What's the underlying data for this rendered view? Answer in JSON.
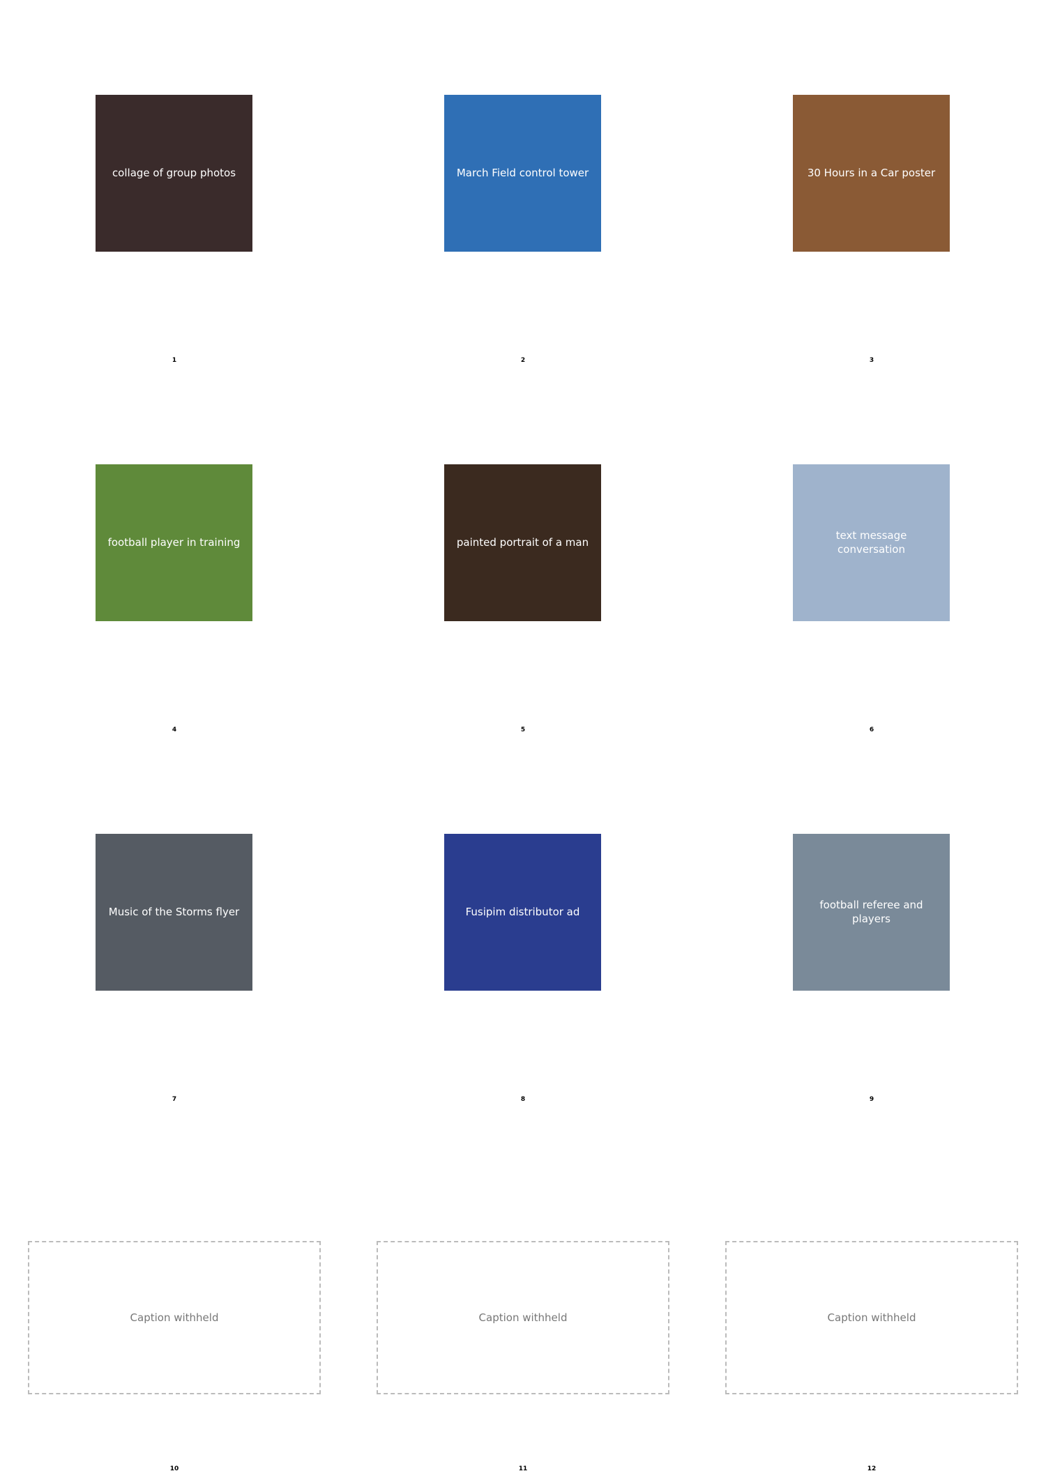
{
  "cells": [
    {
      "number": "1",
      "image": "collage of group photos",
      "bg": "#3a2b2b"
    },
    {
      "number": "2",
      "image": "March Field control tower",
      "bg": "#2f6fb5"
    },
    {
      "number": "3",
      "image": "30 Hours in a Car poster",
      "bg": "#8a5a35"
    },
    {
      "number": "4",
      "image": "football player in training",
      "bg": "#5f8a3a"
    },
    {
      "number": "5",
      "image": "painted portrait of a man",
      "bg": "#3b2a1f"
    },
    {
      "number": "6",
      "image": "text message conversation",
      "bg": "#9fb3cc"
    },
    {
      "number": "7",
      "image": "Music of the Storms flyer",
      "bg": "#555b63"
    },
    {
      "number": "8",
      "image": "Fusipim distributor ad",
      "bg": "#2a3d8f"
    },
    {
      "number": "9",
      "image": "football referee and players",
      "bg": "#7a8a99"
    }
  ],
  "text_cells": [
    {
      "number": "10",
      "note": "Caption withheld"
    },
    {
      "number": "11",
      "note": "Caption withheld"
    },
    {
      "number": "12",
      "note": "Caption withheld"
    }
  ]
}
